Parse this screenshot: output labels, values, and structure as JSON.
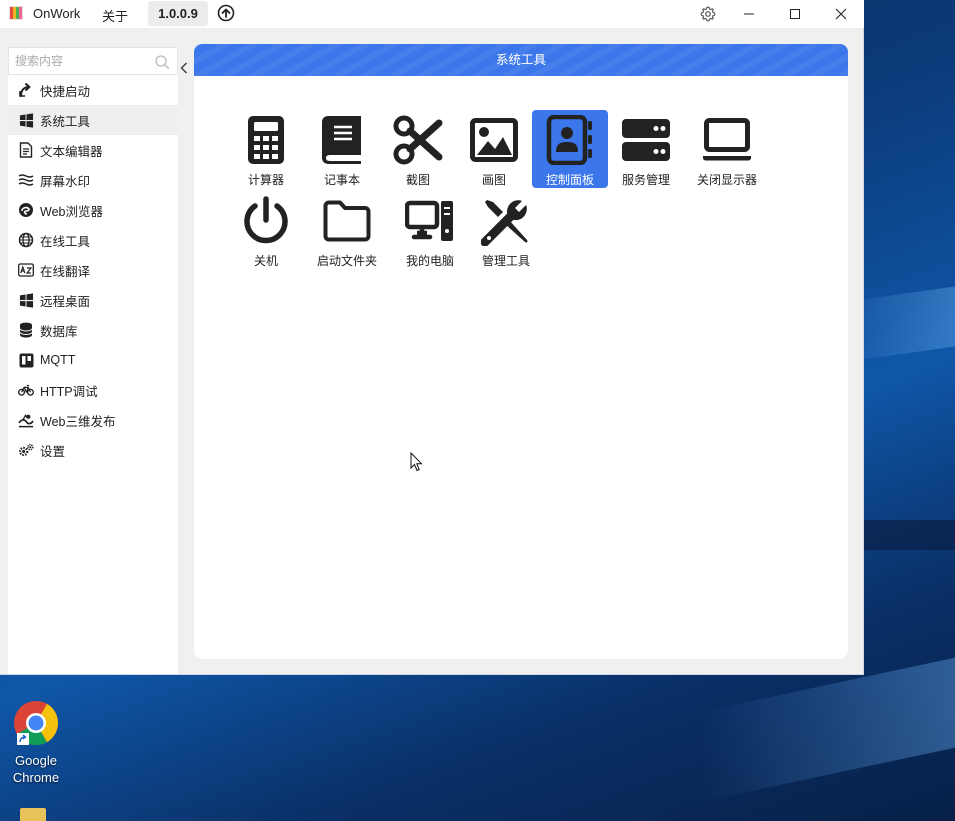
{
  "titlebar": {
    "app_name": "OnWork",
    "menu_about": "关于",
    "version": "1.0.0.9"
  },
  "sidebar": {
    "search_placeholder": "搜索内容",
    "items": [
      {
        "label": "快捷启动",
        "icon": "shortcut-icon"
      },
      {
        "label": "系统工具",
        "icon": "windows-icon"
      },
      {
        "label": "文本编辑器",
        "icon": "document-icon"
      },
      {
        "label": "屏幕水印",
        "icon": "waves-icon"
      },
      {
        "label": "Web浏览器",
        "icon": "edge-icon"
      },
      {
        "label": "在线工具",
        "icon": "globe-icon"
      },
      {
        "label": "在线翻译",
        "icon": "translate-icon"
      },
      {
        "label": "远程桌面",
        "icon": "windows-icon"
      },
      {
        "label": "数据库",
        "icon": "database-icon"
      },
      {
        "label": "MQTT",
        "icon": "board-icon"
      },
      {
        "label": "HTTP调试",
        "icon": "bicycle-icon"
      },
      {
        "label": "Web三维发布",
        "icon": "cube-icon"
      },
      {
        "label": "设置",
        "icon": "gears-icon"
      }
    ],
    "active_index": 1
  },
  "panel": {
    "title": "系统工具",
    "tools": [
      {
        "label": "计算器",
        "icon": "calculator-icon"
      },
      {
        "label": "记事本",
        "icon": "notebook-icon"
      },
      {
        "label": "截图",
        "icon": "scissors-icon"
      },
      {
        "label": "画图",
        "icon": "image-icon"
      },
      {
        "label": "控制面板",
        "icon": "contact-book-icon"
      },
      {
        "label": "服务管理",
        "icon": "server-icon"
      },
      {
        "label": "关闭显示器",
        "icon": "monitor-icon"
      },
      {
        "label": "关机",
        "icon": "power-icon"
      },
      {
        "label": "启动文件夹",
        "icon": "folder-icon"
      },
      {
        "label": "我的电脑",
        "icon": "computer-icon"
      },
      {
        "label": "管理工具",
        "icon": "tools-icon"
      }
    ],
    "selected_index": 4
  },
  "desktop": {
    "icons": [
      {
        "label": "Google Chrome",
        "icon": "chrome-icon"
      }
    ]
  },
  "colors": {
    "accent": "#3b76ea",
    "window_bg": "#f0f0f0"
  }
}
